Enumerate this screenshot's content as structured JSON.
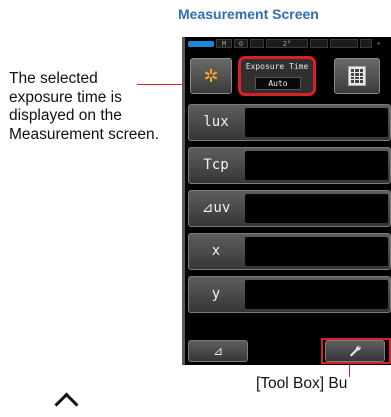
{
  "heading": "Measurement Screen",
  "callout_text": "The selected exposure time is displayed on the Measurement screen.",
  "bottom_label": "[Tool Box] Bu",
  "device": {
    "status_bar": {
      "mode_letter": "M",
      "mode_number": "0",
      "angle": "2°"
    },
    "exposure": {
      "title": "Exposure Time",
      "value": "Auto"
    },
    "rows": [
      {
        "label": "lux"
      },
      {
        "label": "Tcp"
      },
      {
        "label": "⊿uv"
      },
      {
        "label": "x"
      },
      {
        "label": "y"
      }
    ],
    "bottom_bar": {
      "left_glyph": "⊿",
      "right_glyph": "wrench-icon"
    }
  },
  "colors": {
    "accent_red": "#d9202a",
    "heading_blue": "#2e6fb5",
    "battery_blue": "#1e86d8",
    "sun_orange": "#f6a623"
  }
}
